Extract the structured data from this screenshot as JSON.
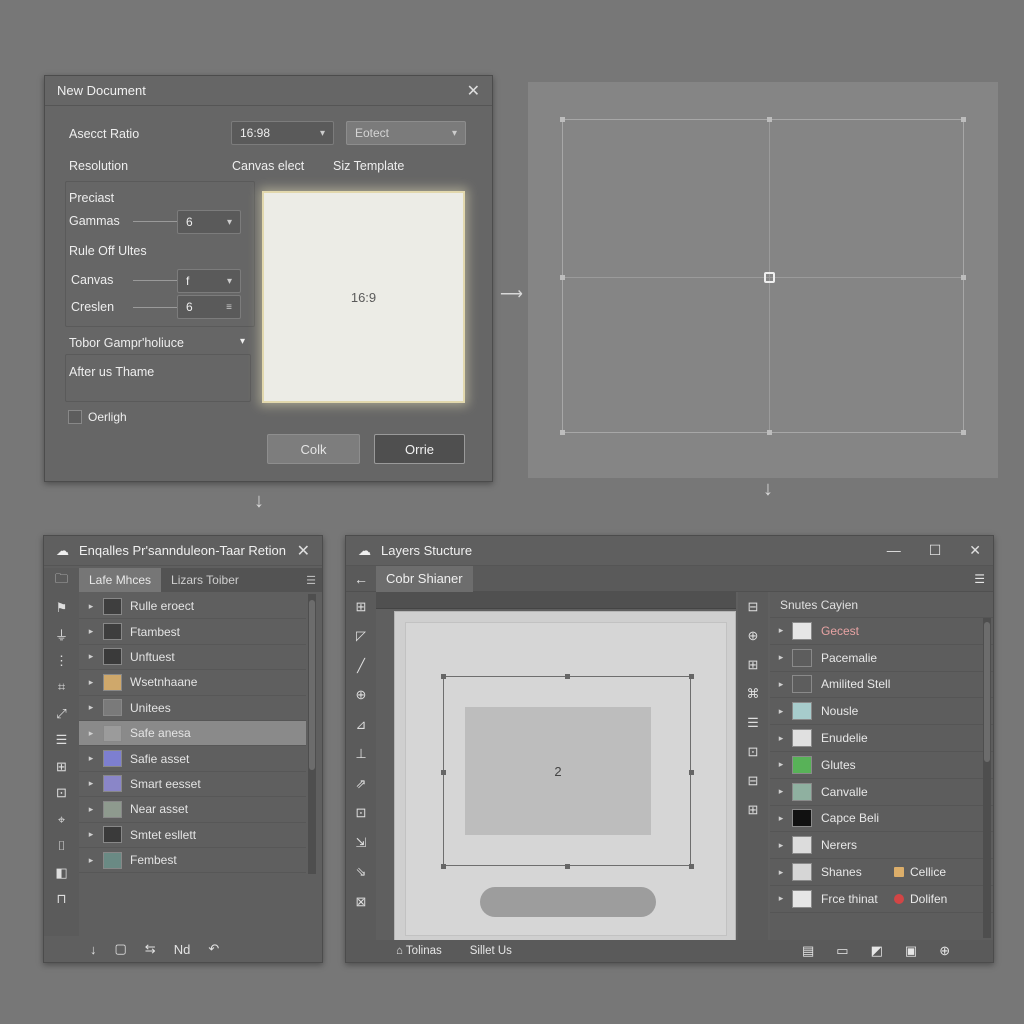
{
  "new_document": {
    "title": "New Document",
    "close": "✕",
    "aspect_ratio_label": "Asecct Ratio",
    "aspect_ratio_value": "16:98",
    "select_placeholder": "Eotect",
    "resolution_label": "Resolution",
    "canvas_select_label": "Canvas elect",
    "size_template_label": "Siz Template",
    "preset_label": "Preciast",
    "gammas_label": "Gammas",
    "gammas_value": "6",
    "rule_off_label": "Rule Off Ultes",
    "canvas_label": "Canvas",
    "canvas_value": "f",
    "creslen_label": "Creslen",
    "creslen_value": "6",
    "tober_label": "Tobor Gampr'holiuce",
    "after_theme_label": "After us Thame",
    "checkbox_label": "Oerligh",
    "preview_ratio": "16:9",
    "ok_button": "Colk",
    "cancel_button": "Orrie"
  },
  "assets_panel": {
    "title": "Enqalles Pr'sannduleon-Taar Retion",
    "close": "✕",
    "tabs": [
      "Lafe Mhces",
      "Lizars Toiber"
    ],
    "tools": [
      "🗀",
      "⚑",
      "⏚",
      "⋮",
      "⌗",
      "⤢",
      "☰",
      "⊞",
      "⊡",
      "⌖",
      "⌷",
      "◧",
      "⊓"
    ],
    "items": [
      {
        "label": "Rulle eroect",
        "color": "#3e3e3e"
      },
      {
        "label": "Ftambest",
        "color": "#3e3e3e"
      },
      {
        "label": "Unftuest",
        "color": "#3a3a3a"
      },
      {
        "label": "Wsetnhaane",
        "color": "#cfa86b"
      },
      {
        "label": "Unitees",
        "color": "#7a7a7a"
      },
      {
        "label": "Safe anesa",
        "color": "#9b9b9b"
      },
      {
        "label": "Safie asset",
        "color": "#7d7fd0"
      },
      {
        "label": "Smart eesset",
        "color": "#8a86c8"
      },
      {
        "label": "Near asset",
        "color": "#8e9a8e"
      },
      {
        "label": "Smtet esllett",
        "color": "#3a3a3a"
      },
      {
        "label": "Fembest",
        "color": "#6a8a84"
      }
    ],
    "footer": [
      "↓",
      "▢",
      "⇆",
      "Nd",
      "↶"
    ]
  },
  "layers_window": {
    "title": "Layers Stucture",
    "controls": [
      "—",
      "☐",
      "✕"
    ],
    "back": "←",
    "tab": "Cobr Shianer",
    "menu": "☰",
    "left_tools": [
      "⊞",
      "◸",
      "╱",
      "⊕",
      "⊿",
      "⊥",
      "⇗",
      "⊡",
      "⇲",
      "⇘",
      "⊠"
    ],
    "mid_tools": [
      "⊟",
      "⊕",
      "⊞",
      "⌘",
      "☰",
      "⊡",
      "⊟",
      "⊞"
    ],
    "center_label": "2",
    "panel_title": "Snutes Cayien",
    "layers": [
      {
        "label": "Gecest",
        "color": "#e6e6e6",
        "red": true
      },
      {
        "label": "Pacemalie",
        "color": "#5d5d5d"
      },
      {
        "label": "Amilited Stell",
        "color": "#5d5d5d"
      },
      {
        "label": "Nousle",
        "color": "#a7cccc"
      },
      {
        "label": "Enudelie",
        "color": "#e0e0e0"
      },
      {
        "label": "Glutes",
        "color": "#58b258"
      },
      {
        "label": "Canvalle",
        "color": "#8fb0a0"
      },
      {
        "label": "Capce Beli",
        "color": "#111111"
      },
      {
        "label": "Nerers",
        "color": "#dcdcdc"
      },
      {
        "label": "Shanes",
        "color": "#d6d6d6"
      },
      {
        "label": "Frce thinat",
        "color": "#e6e6e6"
      }
    ],
    "extras": [
      {
        "label": "Cellice",
        "color": "#dcae6a"
      },
      {
        "label": "Dolifen",
        "color": "#d24545"
      }
    ],
    "status": [
      "⌂ Tolinas",
      "Sillet Us"
    ],
    "footer": [
      "▤",
      "▭",
      "◩",
      "▣",
      "⊕"
    ]
  }
}
